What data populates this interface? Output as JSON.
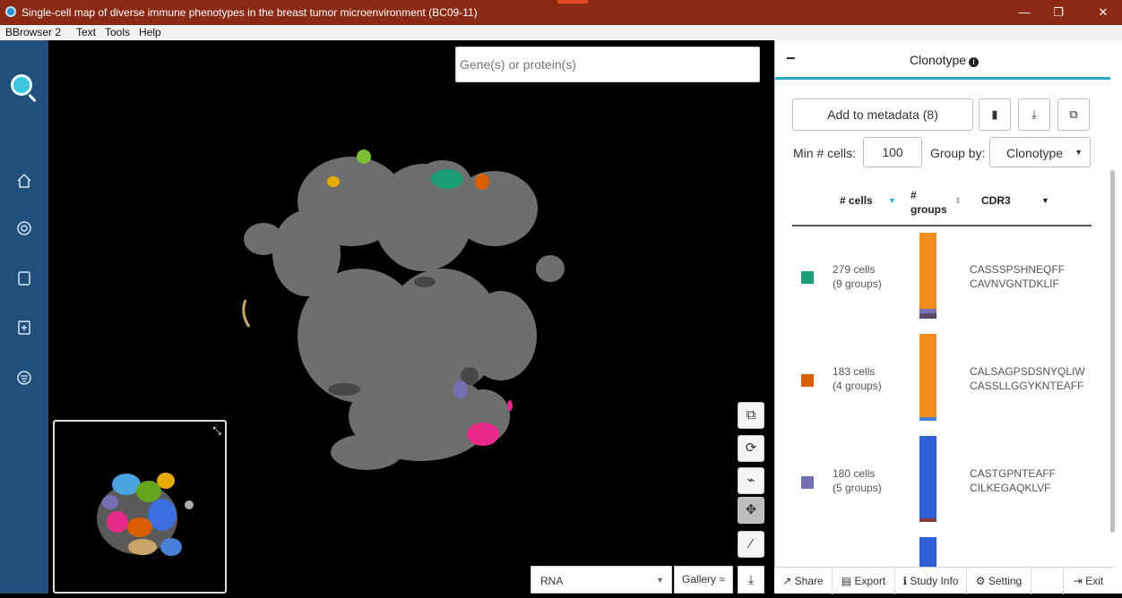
{
  "window": {
    "title": "Single-cell map of diverse immune phenotypes in the breast tumor microenvironment (BC09-11)",
    "minimize": "—",
    "restore": "❐",
    "close": "✕"
  },
  "menu": [
    "BBrowser 2",
    "Text",
    "Tools",
    "Help"
  ],
  "sidebar_icons": [
    "home-icon",
    "lifebuoy-icon",
    "notebook-icon",
    "file-import-icon",
    "filter-icon"
  ],
  "search": {
    "placeholder": "Gene(s) or protein(s)",
    "value": ""
  },
  "map_tools": [
    "copy-icon",
    "refresh-icon",
    "lasso-icon",
    "move-icon",
    "magic-wand-icon"
  ],
  "footer": {
    "rna_value": "RNA",
    "gallery_label": "Gallery ≈"
  },
  "panel": {
    "title": "Clonotype",
    "add_metadata_label": "Add to metadata (8)",
    "min_cells_label": "Min # cells:",
    "min_cells_value": "100",
    "group_by_label": "Group by:",
    "group_by_value": "Clonotype",
    "columns": {
      "cells": "# cells",
      "groups": "# groups",
      "cdr3": "CDR3"
    },
    "rows": [
      {
        "cells": "279 cells",
        "groups": "(9 groups)",
        "cdr3": [
          "CASSSPSHNEQFF",
          "CAVNVGNTDKLIF"
        ],
        "color": "#1b9e77"
      },
      {
        "cells": "183 cells",
        "groups": "(4 groups)",
        "cdr3": [
          "CALSAGPSDSNYQLIW",
          "CASSLLGGYKNTEAFF"
        ],
        "color": "#d95f02"
      },
      {
        "cells": "180 cells",
        "groups": "(5 groups)",
        "cdr3": [
          "CASTGPNTEAFF",
          "CILKEGAQKLVF"
        ],
        "color": "#7570b3"
      }
    ]
  },
  "bottom_bar": [
    "Share",
    "Export",
    "Study Info",
    "Setting",
    "Exit"
  ]
}
